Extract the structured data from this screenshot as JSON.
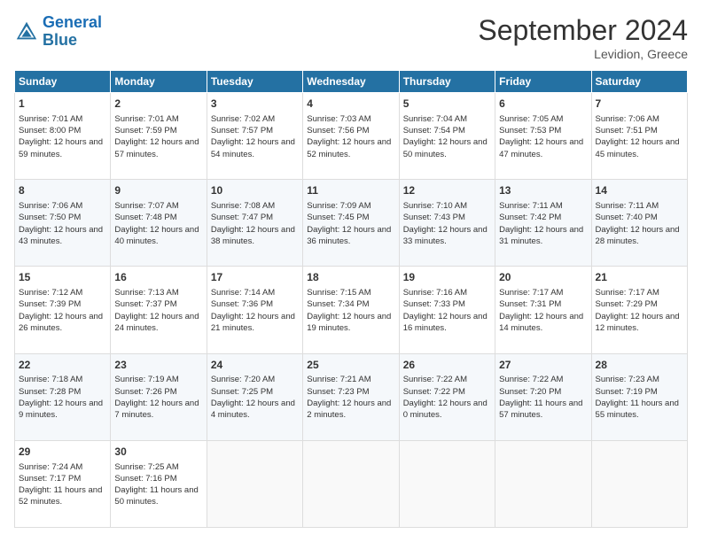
{
  "header": {
    "logo_line1": "General",
    "logo_line2": "Blue",
    "month_year": "September 2024",
    "location": "Levidion, Greece"
  },
  "weekdays": [
    "Sunday",
    "Monday",
    "Tuesday",
    "Wednesday",
    "Thursday",
    "Friday",
    "Saturday"
  ],
  "weeks": [
    [
      {
        "day": "1",
        "sunrise": "7:01 AM",
        "sunset": "8:00 PM",
        "daylight": "12 hours and 59 minutes."
      },
      {
        "day": "2",
        "sunrise": "7:01 AM",
        "sunset": "7:59 PM",
        "daylight": "12 hours and 57 minutes."
      },
      {
        "day": "3",
        "sunrise": "7:02 AM",
        "sunset": "7:57 PM",
        "daylight": "12 hours and 54 minutes."
      },
      {
        "day": "4",
        "sunrise": "7:03 AM",
        "sunset": "7:56 PM",
        "daylight": "12 hours and 52 minutes."
      },
      {
        "day": "5",
        "sunrise": "7:04 AM",
        "sunset": "7:54 PM",
        "daylight": "12 hours and 50 minutes."
      },
      {
        "day": "6",
        "sunrise": "7:05 AM",
        "sunset": "7:53 PM",
        "daylight": "12 hours and 47 minutes."
      },
      {
        "day": "7",
        "sunrise": "7:06 AM",
        "sunset": "7:51 PM",
        "daylight": "12 hours and 45 minutes."
      }
    ],
    [
      {
        "day": "8",
        "sunrise": "7:06 AM",
        "sunset": "7:50 PM",
        "daylight": "12 hours and 43 minutes."
      },
      {
        "day": "9",
        "sunrise": "7:07 AM",
        "sunset": "7:48 PM",
        "daylight": "12 hours and 40 minutes."
      },
      {
        "day": "10",
        "sunrise": "7:08 AM",
        "sunset": "7:47 PM",
        "daylight": "12 hours and 38 minutes."
      },
      {
        "day": "11",
        "sunrise": "7:09 AM",
        "sunset": "7:45 PM",
        "daylight": "12 hours and 36 minutes."
      },
      {
        "day": "12",
        "sunrise": "7:10 AM",
        "sunset": "7:43 PM",
        "daylight": "12 hours and 33 minutes."
      },
      {
        "day": "13",
        "sunrise": "7:11 AM",
        "sunset": "7:42 PM",
        "daylight": "12 hours and 31 minutes."
      },
      {
        "day": "14",
        "sunrise": "7:11 AM",
        "sunset": "7:40 PM",
        "daylight": "12 hours and 28 minutes."
      }
    ],
    [
      {
        "day": "15",
        "sunrise": "7:12 AM",
        "sunset": "7:39 PM",
        "daylight": "12 hours and 26 minutes."
      },
      {
        "day": "16",
        "sunrise": "7:13 AM",
        "sunset": "7:37 PM",
        "daylight": "12 hours and 24 minutes."
      },
      {
        "day": "17",
        "sunrise": "7:14 AM",
        "sunset": "7:36 PM",
        "daylight": "12 hours and 21 minutes."
      },
      {
        "day": "18",
        "sunrise": "7:15 AM",
        "sunset": "7:34 PM",
        "daylight": "12 hours and 19 minutes."
      },
      {
        "day": "19",
        "sunrise": "7:16 AM",
        "sunset": "7:33 PM",
        "daylight": "12 hours and 16 minutes."
      },
      {
        "day": "20",
        "sunrise": "7:17 AM",
        "sunset": "7:31 PM",
        "daylight": "12 hours and 14 minutes."
      },
      {
        "day": "21",
        "sunrise": "7:17 AM",
        "sunset": "7:29 PM",
        "daylight": "12 hours and 12 minutes."
      }
    ],
    [
      {
        "day": "22",
        "sunrise": "7:18 AM",
        "sunset": "7:28 PM",
        "daylight": "12 hours and 9 minutes."
      },
      {
        "day": "23",
        "sunrise": "7:19 AM",
        "sunset": "7:26 PM",
        "daylight": "12 hours and 7 minutes."
      },
      {
        "day": "24",
        "sunrise": "7:20 AM",
        "sunset": "7:25 PM",
        "daylight": "12 hours and 4 minutes."
      },
      {
        "day": "25",
        "sunrise": "7:21 AM",
        "sunset": "7:23 PM",
        "daylight": "12 hours and 2 minutes."
      },
      {
        "day": "26",
        "sunrise": "7:22 AM",
        "sunset": "7:22 PM",
        "daylight": "12 hours and 0 minutes."
      },
      {
        "day": "27",
        "sunrise": "7:22 AM",
        "sunset": "7:20 PM",
        "daylight": "11 hours and 57 minutes."
      },
      {
        "day": "28",
        "sunrise": "7:23 AM",
        "sunset": "7:19 PM",
        "daylight": "11 hours and 55 minutes."
      }
    ],
    [
      {
        "day": "29",
        "sunrise": "7:24 AM",
        "sunset": "7:17 PM",
        "daylight": "11 hours and 52 minutes."
      },
      {
        "day": "30",
        "sunrise": "7:25 AM",
        "sunset": "7:16 PM",
        "daylight": "11 hours and 50 minutes."
      },
      null,
      null,
      null,
      null,
      null
    ]
  ]
}
